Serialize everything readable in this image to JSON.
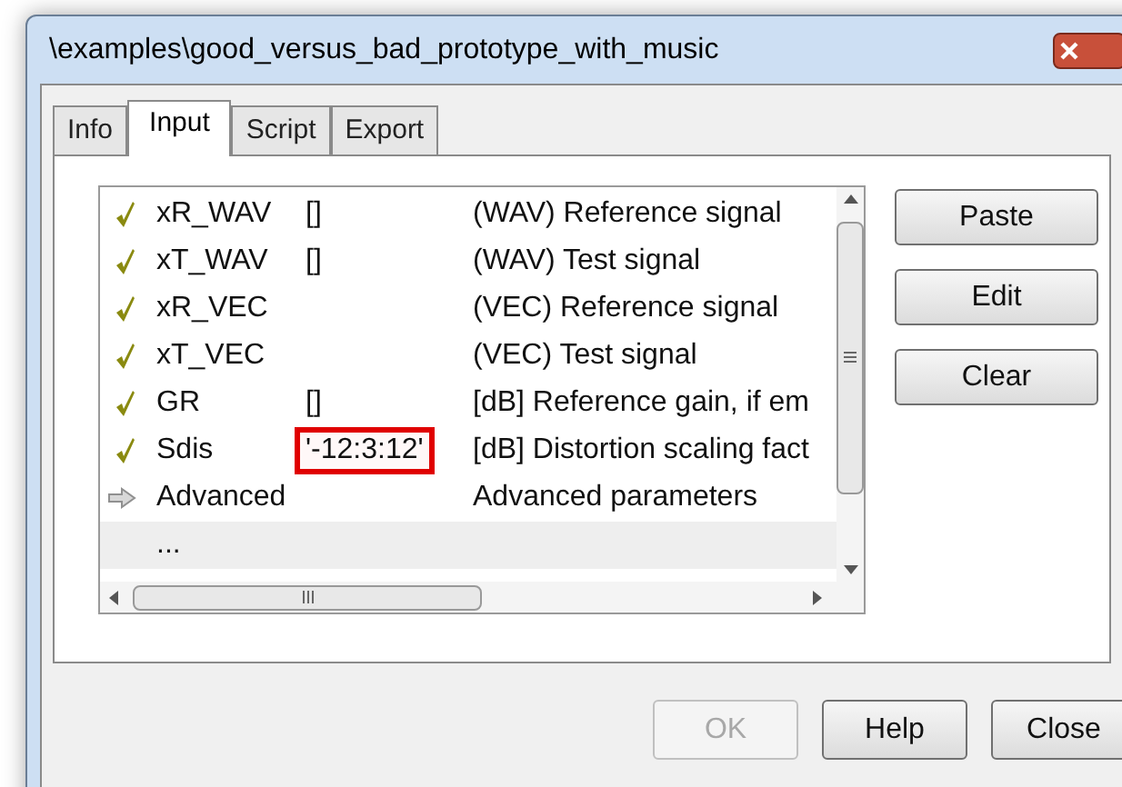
{
  "window": {
    "title": "\\examples\\good_versus_bad_prototype_with_music"
  },
  "tabs": [
    {
      "label": "Info",
      "selected": false
    },
    {
      "label": "Input",
      "selected": true
    },
    {
      "label": "Script",
      "selected": false
    },
    {
      "label": "Export",
      "selected": false
    }
  ],
  "parameters": [
    {
      "kind": "check",
      "name": "xR_WAV",
      "value": "[]",
      "description": "(WAV) Reference signal",
      "highlighted": false,
      "selected": false
    },
    {
      "kind": "check",
      "name": "xT_WAV",
      "value": "[]",
      "description": "(WAV) Test signal",
      "highlighted": false,
      "selected": false
    },
    {
      "kind": "check",
      "name": "xR_VEC",
      "description": "(VEC) Reference signal",
      "highlighted": false,
      "selected": false
    },
    {
      "kind": "check",
      "name": "xT_VEC",
      "description": "(VEC) Test signal",
      "highlighted": false,
      "selected": false
    },
    {
      "kind": "check",
      "name": "GR",
      "value": "[]",
      "description": "[dB] Reference gain, if em",
      "highlighted": false,
      "selected": false
    },
    {
      "kind": "check",
      "name": "Sdis",
      "value": "'-12:3:12'",
      "description": "[dB] Distortion scaling fact",
      "highlighted": true,
      "selected": false
    },
    {
      "kind": "arrow",
      "name": "Advanced",
      "description": "Advanced parameters",
      "highlighted": false,
      "selected": false
    },
    {
      "kind": "plain",
      "name": "...",
      "highlighted": false,
      "selected": true
    }
  ],
  "side_buttons": [
    {
      "label": "Paste"
    },
    {
      "label": "Edit"
    },
    {
      "label": "Clear"
    }
  ],
  "footer_buttons": [
    {
      "label": "OK",
      "disabled": true
    },
    {
      "label": "Help",
      "disabled": false
    },
    {
      "label": "Close",
      "disabled": false
    }
  ]
}
